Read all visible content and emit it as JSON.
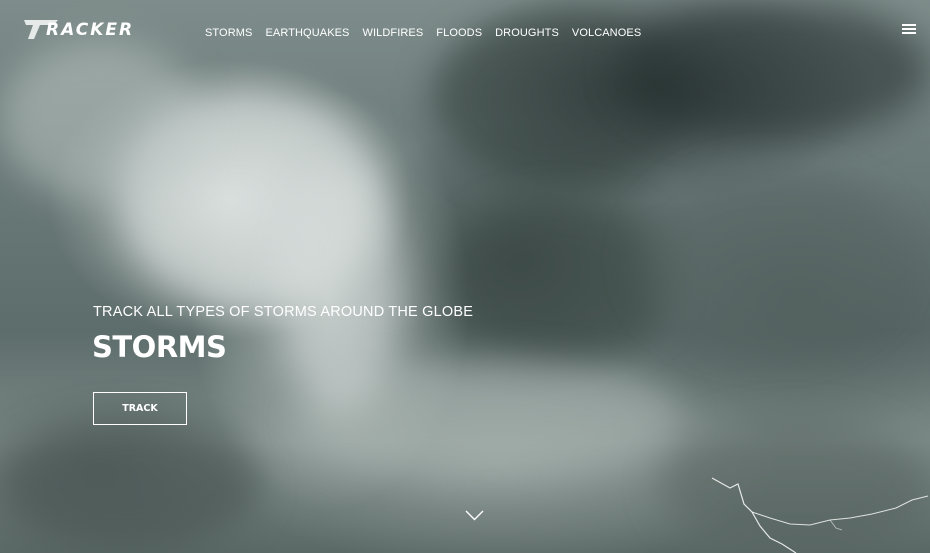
{
  "brand": {
    "logo_text": "RACKER",
    "logo_icon": "t-wing-logo-icon"
  },
  "nav": {
    "items": [
      {
        "label": "STORMS"
      },
      {
        "label": "EARTHQUAKES"
      },
      {
        "label": "WILDFIRES"
      },
      {
        "label": "FLOODS"
      },
      {
        "label": "DROUGHTS"
      },
      {
        "label": "VOLCANOES"
      }
    ],
    "menu_icon": "hamburger-menu-icon"
  },
  "hero": {
    "tagline": "TRACK ALL TYPES OF STORMS AROUND THE GLOBE",
    "title": "STORMS",
    "cta_label": "TRACK",
    "scroll_icon": "chevron-down-icon",
    "background": "storm-clouds-with-lightning"
  },
  "colors": {
    "text": "#ffffff",
    "sky_dark": "#3f4c4b",
    "sky_light": "#d8dedc"
  }
}
